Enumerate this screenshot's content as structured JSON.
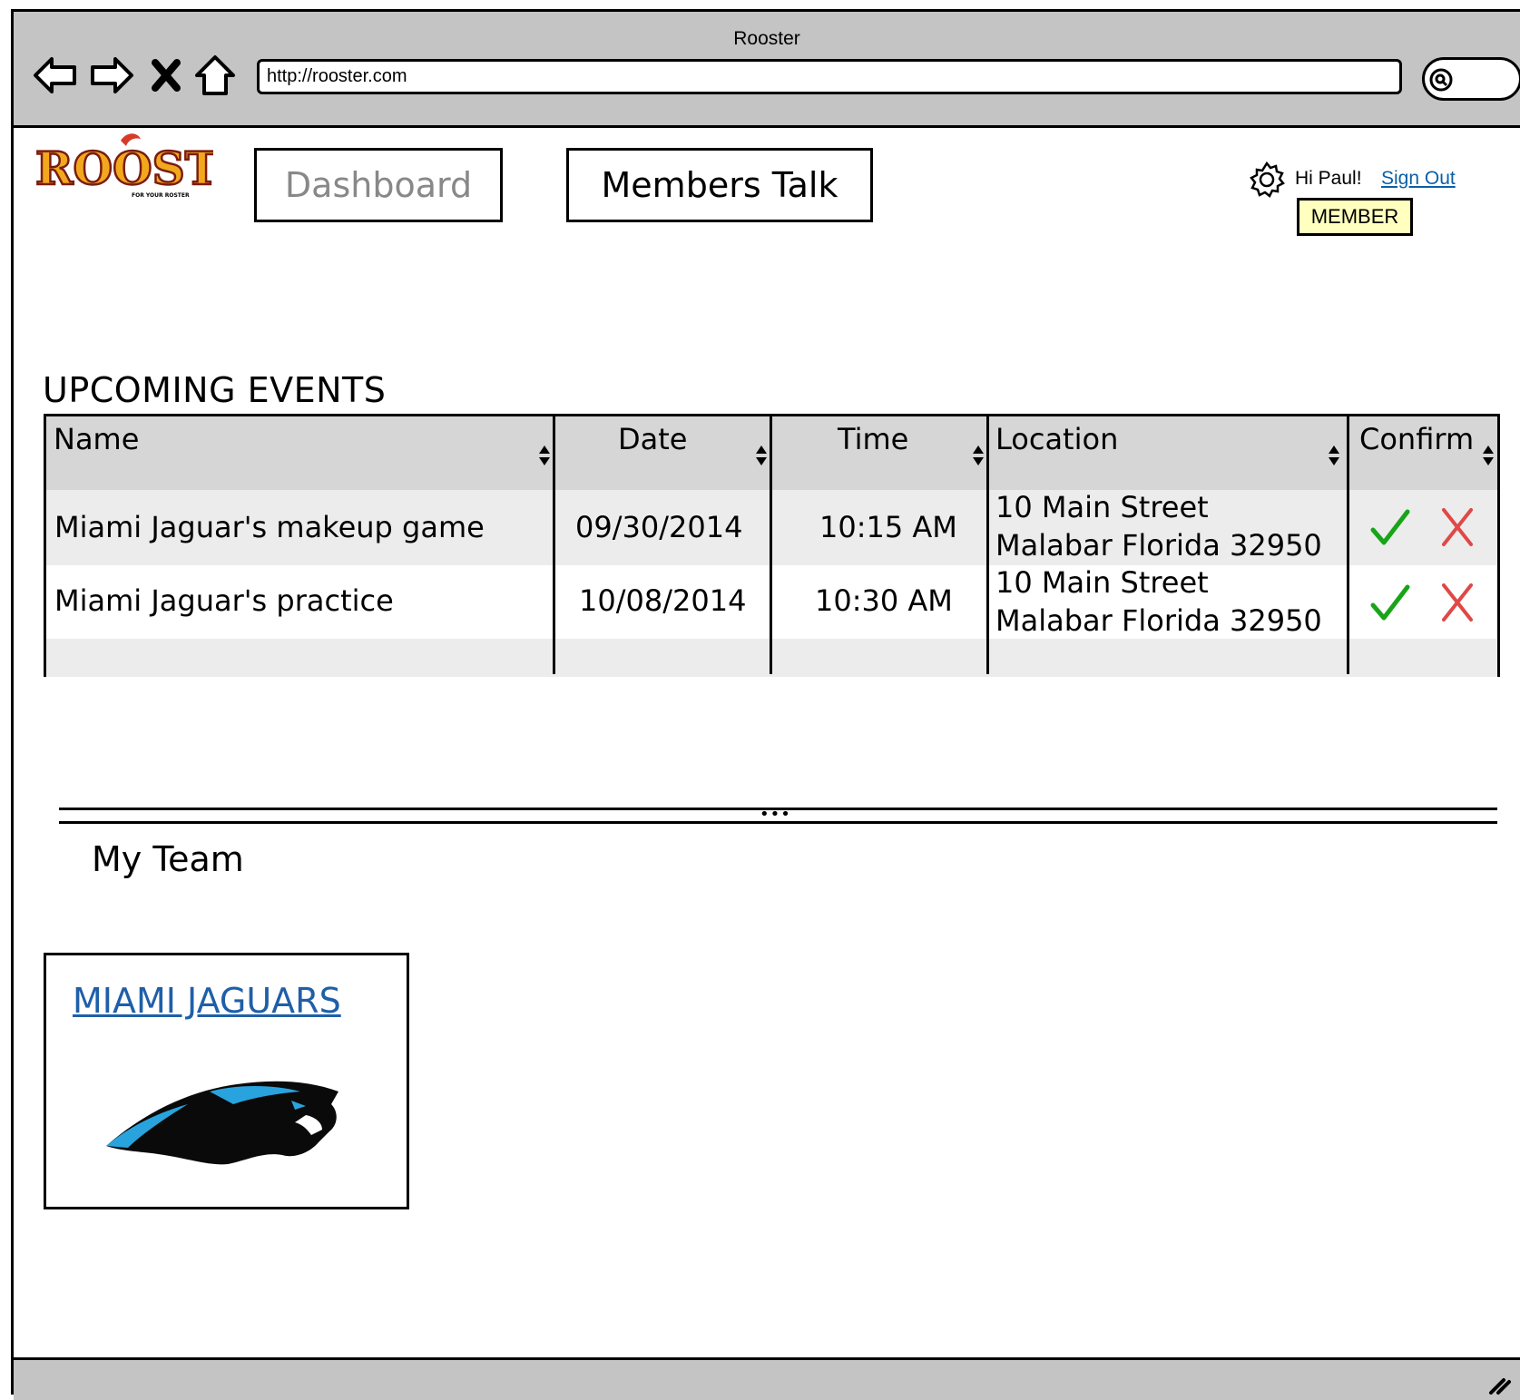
{
  "browser": {
    "window_title": "Rooster",
    "url": "http://rooster.com",
    "icons": [
      "back-arrow-icon",
      "forward-arrow-icon",
      "close-x-icon",
      "home-icon",
      "search-icon"
    ]
  },
  "header": {
    "logo_text": "ROOSTER",
    "logo_tagline": "FOR YOUR ROSTER",
    "nav": {
      "dashboard": "Dashboard",
      "members_talk": "Members Talk"
    },
    "greeting": "Hi Paul!",
    "sign_out": "Sign Out",
    "role_badge": "MEMBER"
  },
  "events": {
    "title": "UPCOMING EVENTS",
    "columns": [
      "Name",
      "Date",
      "Time",
      "Location",
      "Confirm"
    ],
    "rows": [
      {
        "name": "Miami Jaguar's makeup game",
        "date": "09/30/2014",
        "time": "10:15 AM",
        "location_line1": "10 Main Street",
        "location_line2": "Malabar Florida 32950"
      },
      {
        "name": "Miami Jaguar's practice",
        "date": "10/08/2014",
        "time": "10:30 AM",
        "location_line1": "10 Main Street",
        "location_line2": "Malabar Florida 32950"
      }
    ]
  },
  "team": {
    "title": "My Team",
    "card_link": "MIAMI JAGUARS"
  },
  "colors": {
    "chrome": "#c4c4c4",
    "header_row": "#d6d6d6",
    "stripe_row": "#ececec",
    "link": "#1f5fa8",
    "badge_bg": "#ffffbf",
    "confirm_green": "#17a517",
    "decline_red": "#e04848"
  }
}
